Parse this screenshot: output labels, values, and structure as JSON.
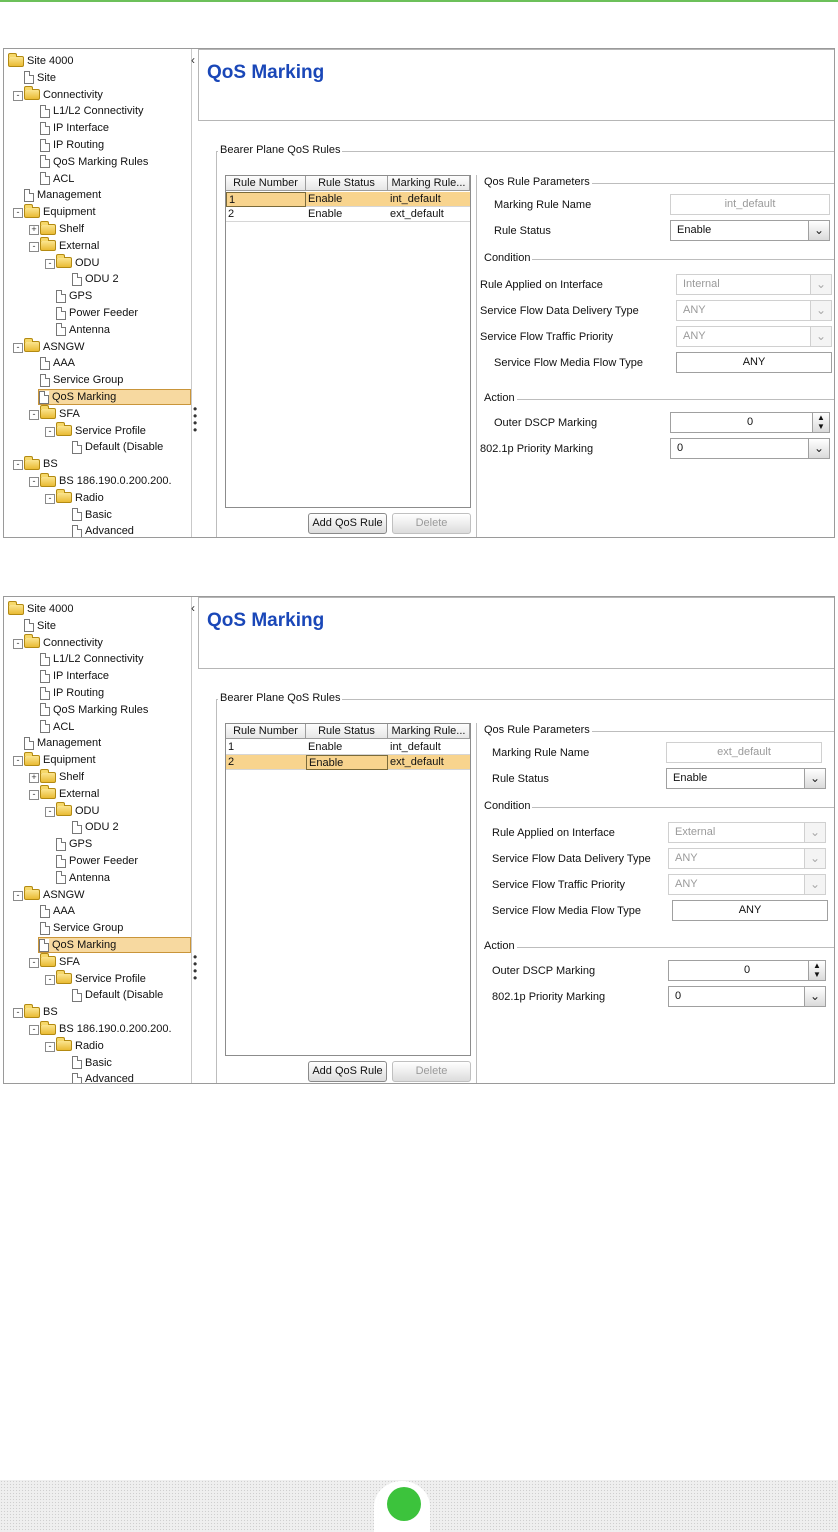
{
  "tree": {
    "nodes": [
      {
        "label": "Site 4000",
        "kind": "folder",
        "depth": 0
      },
      {
        "label": "Site",
        "kind": "doc",
        "depth": 1
      },
      {
        "label": "Connectivity",
        "kind": "folder",
        "depth": 1,
        "expander": "-"
      },
      {
        "label": "L1/L2 Connectivity",
        "kind": "doc",
        "depth": 2
      },
      {
        "label": "IP Interface",
        "kind": "doc",
        "depth": 2
      },
      {
        "label": "IP Routing",
        "kind": "doc",
        "depth": 2
      },
      {
        "label": "QoS Marking Rules",
        "kind": "doc",
        "depth": 2
      },
      {
        "label": "ACL",
        "kind": "doc",
        "depth": 2
      },
      {
        "label": "Management",
        "kind": "doc",
        "depth": 1
      },
      {
        "label": "Equipment",
        "kind": "folder",
        "depth": 1,
        "expander": "-"
      },
      {
        "label": "Shelf",
        "kind": "folder",
        "depth": 2,
        "expander": "+"
      },
      {
        "label": "External",
        "kind": "folder",
        "depth": 2,
        "expander": "-"
      },
      {
        "label": "ODU",
        "kind": "folder",
        "depth": 3,
        "expander": "-"
      },
      {
        "label": "ODU 2",
        "kind": "doc",
        "depth": 4
      },
      {
        "label": "GPS",
        "kind": "doc",
        "depth": 3
      },
      {
        "label": "Power Feeder",
        "kind": "doc",
        "depth": 3
      },
      {
        "label": "Antenna",
        "kind": "doc",
        "depth": 3
      },
      {
        "label": "ASNGW",
        "kind": "folder",
        "depth": 1,
        "expander": "-"
      },
      {
        "label": "AAA",
        "kind": "doc",
        "depth": 2
      },
      {
        "label": "Service Group",
        "kind": "doc",
        "depth": 2
      },
      {
        "label": "QoS Marking",
        "kind": "doc",
        "depth": 2,
        "selected": true
      },
      {
        "label": "SFA",
        "kind": "folder",
        "depth": 2,
        "expander": "-"
      },
      {
        "label": "Service Profile",
        "kind": "folder",
        "depth": 3,
        "expander": "-"
      },
      {
        "label": "Default (Disable",
        "kind": "doc",
        "depth": 4
      },
      {
        "label": "BS",
        "kind": "folder",
        "depth": 1,
        "expander": "-"
      },
      {
        "label": "BS 186.190.0.200.200.",
        "kind": "folder",
        "depth": 2,
        "expander": "-"
      },
      {
        "label": "Radio",
        "kind": "folder",
        "depth": 3,
        "expander": "-"
      },
      {
        "label": "Basic",
        "kind": "doc",
        "depth": 4
      },
      {
        "label": "Advanced",
        "kind": "doc",
        "depth": 4
      }
    ]
  },
  "shots": [
    {
      "title": "QoS Marking",
      "group_label": "Bearer Plane QoS Rules",
      "columns": [
        "Rule Number",
        "Rule Status",
        "Marking Rule..."
      ],
      "rows": [
        [
          "1",
          "Enable",
          "int_default"
        ],
        [
          "2",
          "Enable",
          "ext_default"
        ]
      ],
      "selected_row": 0,
      "add_button": "Add QoS Rule",
      "delete_button": "Delete",
      "params_label": "Qos Rule Parameters",
      "marking_rule_name_label": "Marking Rule Name",
      "marking_rule_name": "int_default",
      "rule_status_label": "Rule Status",
      "rule_status": "Enable",
      "condition_label": "Condition",
      "interface_label": "Rule Applied on Interface",
      "interface_value": "Internal",
      "delivery_label": "Service Flow Data Delivery Type",
      "delivery_value": "ANY",
      "priority_label": "Service Flow Traffic Priority",
      "priority_value": "ANY",
      "media_label": "Service Flow Media Flow Type",
      "media_value": "ANY",
      "action_label": "Action",
      "dscp_label": "Outer DSCP Marking",
      "dscp_value": "0",
      "p8021_label": "802.1p Priority Marking",
      "p8021_value": "0"
    },
    {
      "title": "QoS Marking",
      "group_label": "Bearer Plane QoS Rules",
      "columns": [
        "Rule Number",
        "Rule Status",
        "Marking Rule..."
      ],
      "rows": [
        [
          "1",
          "Enable",
          "int_default"
        ],
        [
          "2",
          "Enable",
          "ext_default"
        ]
      ],
      "selected_row": 1,
      "add_button": "Add QoS Rule",
      "delete_button": "Delete",
      "params_label": "Qos Rule Parameters",
      "marking_rule_name_label": "Marking Rule Name",
      "marking_rule_name": "ext_default",
      "rule_status_label": "Rule Status",
      "rule_status": "Enable",
      "condition_label": "Condition",
      "interface_label": "Rule Applied on Interface",
      "interface_value": "External",
      "delivery_label": "Service Flow Data Delivery Type",
      "delivery_value": "ANY",
      "priority_label": "Service Flow Traffic Priority",
      "priority_value": "ANY",
      "media_label": "Service Flow Media Flow Type",
      "media_value": "ANY",
      "action_label": "Action",
      "dscp_label": "Outer DSCP Marking",
      "dscp_value": "0",
      "p8021_label": "802.1p Priority Marking",
      "p8021_value": "0"
    }
  ],
  "colors": {
    "title": "#1a47b8",
    "selection": "#f8d48e",
    "top_rule": "#6cc05a",
    "footer_dot": "#3cc33c"
  }
}
